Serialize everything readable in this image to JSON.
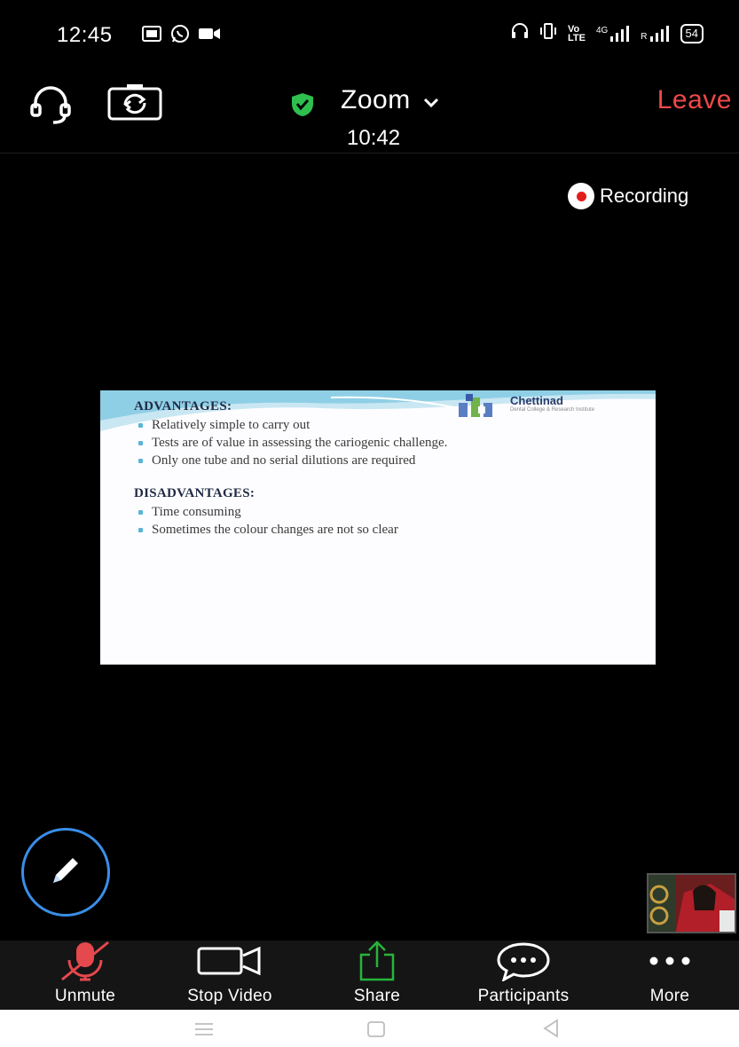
{
  "status_bar": {
    "time": "12:45",
    "network_label": "4G",
    "battery": "54"
  },
  "header": {
    "app_title": "Zoom",
    "meeting_timer": "10:42",
    "leave_label": "Leave",
    "leave_color": "#f04848",
    "secure_color": "#2fbf4e"
  },
  "recording": {
    "label": "Recording"
  },
  "slide": {
    "logo_name": "Chettinad",
    "logo_subtitle": "Dental College & Research Institute",
    "advantages_heading": "ADVANTAGES:",
    "advantages": [
      "Relatively simple to carry out",
      "Tests are of value in assessing the cariogenic challenge.",
      "Only one tube and no serial dilutions are required"
    ],
    "disadvantages_heading": "DISADVANTAGES:",
    "disadvantages": [
      "Time consuming",
      "Sometimes the colour changes are not so clear"
    ]
  },
  "toolbar": {
    "unmute_label": "Unmute",
    "stop_video_label": "Stop Video",
    "share_label": "Share",
    "participants_label": "Participants",
    "more_label": "More",
    "unmute_color": "#e5484d",
    "share_color": "#27b53c"
  },
  "icons": {
    "status_left": [
      "gallery-icon",
      "whatsapp-icon",
      "video-icon"
    ],
    "status_right": [
      "headset-icon",
      "vibrate-icon",
      "volte-icon",
      "signal-icon",
      "signal-icon",
      "battery-icon"
    ],
    "header_left": [
      "audio-headset-icon",
      "switch-camera-icon"
    ],
    "nav": [
      "menu-icon",
      "home-icon",
      "back-icon"
    ]
  }
}
